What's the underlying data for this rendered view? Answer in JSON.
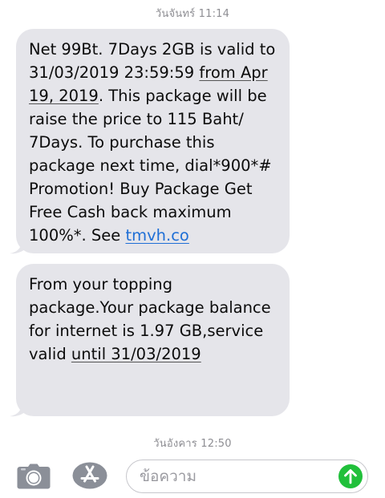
{
  "conversation": {
    "timestamp_top": "วันจันทร์ 11:14",
    "timestamp_bottom": "วันอังคาร 12:50",
    "messages": [
      {
        "lines": [
          {
            "parts": [
              {
                "text": "Net 99Bt. 7Days 2GB is valid to",
                "style": "plain"
              }
            ]
          },
          {
            "parts": [
              {
                "text": "31/03/2019 23:59:59 ",
                "style": "plain"
              },
              {
                "text": "from Apr",
                "style": "underline"
              }
            ]
          },
          {
            "parts": [
              {
                "text": "19, 2019",
                "style": "underline"
              },
              {
                "text": ". This package will be",
                "style": "plain"
              }
            ]
          },
          {
            "parts": [
              {
                "text": "raise the price to 115 Baht/",
                "style": "plain"
              }
            ]
          },
          {
            "parts": [
              {
                "text": "7Days. To purchase this",
                "style": "plain"
              }
            ]
          },
          {
            "parts": [
              {
                "text": "package next time, dial*900*#",
                "style": "plain"
              }
            ]
          },
          {
            "parts": [
              {
                "text": "Promotion! Buy Package Get",
                "style": "plain"
              }
            ]
          },
          {
            "parts": [
              {
                "text": "Free Cash back maximum",
                "style": "plain"
              }
            ]
          },
          {
            "parts": [
              {
                "text": "100%*. See ",
                "style": "plain"
              },
              {
                "text": "tmvh.co",
                "style": "link"
              }
            ]
          }
        ]
      },
      {
        "lines": [
          {
            "parts": [
              {
                "text": "From your topping",
                "style": "plain"
              }
            ]
          },
          {
            "parts": [
              {
                "text": "package.Your package balance",
                "style": "plain"
              }
            ]
          },
          {
            "parts": [
              {
                "text": "for internet is  1.97 GB,service",
                "style": "plain"
              }
            ]
          },
          {
            "parts": [
              {
                "text": "valid ",
                "style": "plain"
              },
              {
                "text": "until 31/03/2019",
                "style": "underline"
              }
            ]
          }
        ]
      }
    ]
  },
  "input_bar": {
    "placeholder": "ข้อความ",
    "camera_icon": "camera-icon",
    "appstore_icon": "app-store-icon",
    "send_icon": "arrow-up-icon",
    "send_color": "#21c03b"
  },
  "colors": {
    "bubble": "#e5e5ea",
    "timestamp": "#8e8e93",
    "link": "#1f6fd6"
  }
}
